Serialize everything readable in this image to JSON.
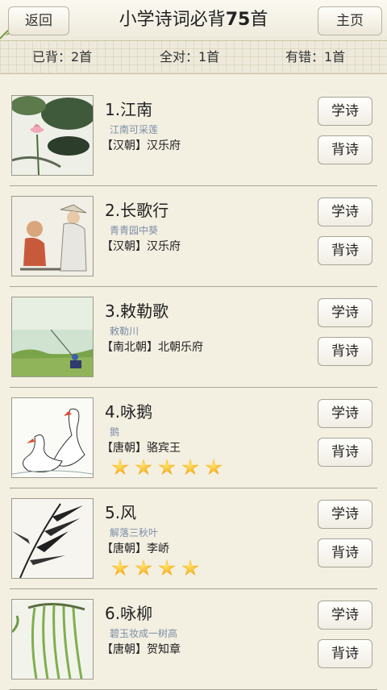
{
  "header": {
    "back_label": "返回",
    "title_prefix": "小学诗词必背",
    "title_number": "75",
    "title_suffix": "首",
    "home_label": "主页"
  },
  "stats": {
    "recited": "已背：2首",
    "all_correct": "全对：1首",
    "has_errors": "有错：1首"
  },
  "buttons": {
    "learn": "学诗",
    "recite": "背诗"
  },
  "poems": [
    {
      "title": "1.江南",
      "line": "江南可采莲",
      "author": "【汉朝】汉乐府",
      "stars": 0,
      "image": "lotus-painting"
    },
    {
      "title": "2.长歌行",
      "line": "青青园中葵",
      "author": "【汉朝】汉乐府",
      "stars": 0,
      "image": "elder-and-child-painting"
    },
    {
      "title": "3.敕勒歌",
      "line": "敕勒川",
      "author": "【南北朝】北朝乐府",
      "stars": 0,
      "image": "grassland-painting"
    },
    {
      "title": "4.咏鹅",
      "line": "鹅",
      "author": "【唐朝】骆宾王",
      "stars": 5,
      "image": "geese-painting"
    },
    {
      "title": "5.风",
      "line": "解落三秋叶",
      "author": "【唐朝】李峤",
      "stars": 4,
      "image": "bamboo-painting"
    },
    {
      "title": "6.咏柳",
      "line": "碧玉妆成一树高",
      "author": "【唐朝】贺知章",
      "stars": 0,
      "image": "willow-painting"
    }
  ]
}
